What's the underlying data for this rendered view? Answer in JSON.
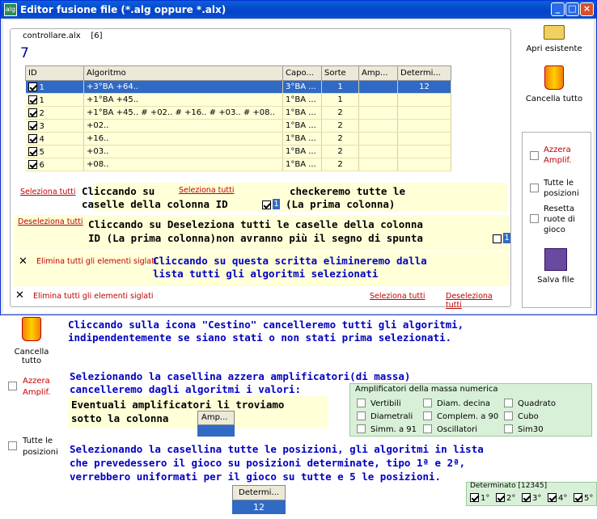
{
  "window": {
    "title": "Editor fusione file (*.alg oppure *.alx)",
    "buttons": {
      "minimize": "_",
      "maximize": "□",
      "close": "×"
    }
  },
  "group": {
    "file": "controllare.alx",
    "file_count": "[6]",
    "count": "7"
  },
  "table": {
    "headers": [
      "ID",
      "Algoritmo",
      "Capo...",
      "Sorte",
      "Amp...",
      "Determi..."
    ],
    "rows": [
      {
        "id": "1",
        "alg": "+3°BA +64..",
        "capo": "3°BA ...",
        "sorte": "1",
        "amp": "",
        "det": "12",
        "selected": true
      },
      {
        "id": "1",
        "alg": "+1°BA +45..",
        "capo": "1°BA ...",
        "sorte": "1",
        "amp": "",
        "det": ""
      },
      {
        "id": "2",
        "alg": "+1°BA +45.. # +02.. # +16.. # +03.. # +08..",
        "capo": "1°BA ...",
        "sorte": "2",
        "amp": "",
        "det": ""
      },
      {
        "id": "3",
        "alg": "+02..",
        "capo": "1°BA ...",
        "sorte": "2",
        "amp": "",
        "det": ""
      },
      {
        "id": "4",
        "alg": "+16..",
        "capo": "1°BA ...",
        "sorte": "2",
        "amp": "",
        "det": ""
      },
      {
        "id": "5",
        "alg": "+03..",
        "capo": "1°BA ...",
        "sorte": "2",
        "amp": "",
        "det": ""
      },
      {
        "id": "6",
        "alg": "+08..",
        "capo": "1°BA ...",
        "sorte": "2",
        "amp": "",
        "det": ""
      }
    ]
  },
  "notes": {
    "sel_link": "Seleziona tutti",
    "sel_text1": "Cliccando su",
    "sel_text2": "checkeremo tutte le",
    "sel_text3": "caselle della colonna ID",
    "sel_text4": "(La prima colonna)",
    "desel_link": "Deseleziona tutti",
    "desel_text1": "Cliccando su Deseleziona tutti le caselle della colonna",
    "desel_text2": "ID (La prima colonna)non avranno più il segno di spunta",
    "elim_link": "Elimina tutti gli elementi siglati",
    "elim_text1": "Cliccando su questa scritta elimineremo dalla",
    "elim_text2": "lista tutti gli algoritmi selezionati",
    "one": "1"
  },
  "footer": {
    "elimina": "Elimina tutti gli elementi siglati",
    "seleziona": "Seleziona tutti",
    "deseleziona": "Deseleziona tutti"
  },
  "sidebar": {
    "apri": "Apri esistente",
    "cancella": "Cancella tutto",
    "azzera": "Azzera Amplif.",
    "tutte": "Tutte le posizioni",
    "resetta": "Resetta ruote di gioco",
    "salva": "Salva file"
  },
  "below": {
    "cancella_label": "Cancella tutto",
    "cestino1": "Cliccando sulla icona \"Cestino\" cancelleremo tutti gli algoritmi,",
    "cestino2": "indipendentemente se siano stati o non stati prima selezionati.",
    "azzera_label": "Azzera Amplif.",
    "azzera1": "Selezionando la casellina azzera amplificatori(di massa)",
    "azzera2": "cancelleremo dagli algoritmi i valori:",
    "azzera3": "Eventuali amplificatori li troviamo",
    "azzera4": "sotto la colonna",
    "amp_btn": "Amp...",
    "tutte_label": "Tutte le posizioni",
    "tutte1": "Selezionando la casellina tutte le posizioni, gli algoritmi in lista",
    "tutte2": "che prevedessero il gioco su posizioni determinate, tipo 1ª e 2ª,",
    "tutte3": "verrebbero uniformati per il gioco su tutte e 5 le posizioni.",
    "det_btn": "Determi...",
    "det_val": "12"
  },
  "amp_group": {
    "title": "Amplificatori della massa numerica",
    "items": [
      "Vertibili",
      "Diam. decina",
      "Quadrato",
      "Diametrali",
      "Complem. a 90",
      "Cubo",
      "Simm. a 91",
      "Oscillatori",
      "Sim30"
    ]
  },
  "det_group": {
    "title": "Determinato [12345]",
    "items": [
      "1°",
      "2°",
      "3°",
      "4°",
      "5°"
    ]
  }
}
